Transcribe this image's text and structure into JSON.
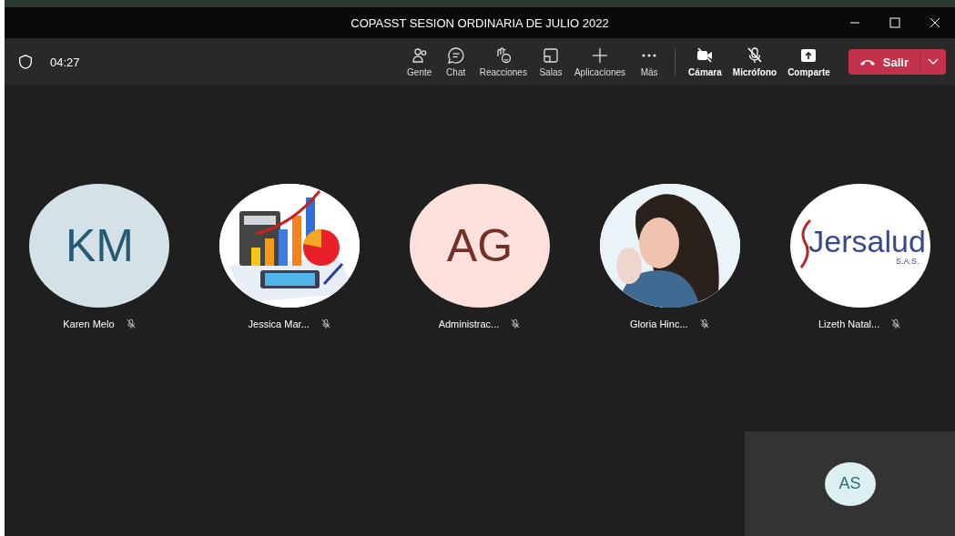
{
  "window": {
    "title": "COPASST SESION ORDINARIA DE JULIO 2022"
  },
  "meeting": {
    "timer": "04:27"
  },
  "toolbar": [
    {
      "kind": "people",
      "label": "Gente"
    },
    {
      "kind": "chat",
      "label": "Chat"
    },
    {
      "kind": "reactions",
      "label": "Reacciones"
    },
    {
      "kind": "rooms",
      "label": "Salas"
    },
    {
      "kind": "apps",
      "label": "Aplicaciones"
    },
    {
      "kind": "more",
      "label": "Más"
    }
  ],
  "controls": [
    {
      "kind": "camera",
      "label": "Cámara",
      "on": false
    },
    {
      "kind": "mic",
      "label": "Micrófono",
      "on": false
    },
    {
      "kind": "share",
      "label": "Comparte",
      "on": true
    }
  ],
  "leave_button": {
    "label": "Salir"
  },
  "participants": [
    {
      "name": "Karen Melo",
      "muted": true,
      "avatar": {
        "kind": "initials",
        "initials": "KM",
        "color": "#d4e2e8"
      }
    },
    {
      "name": "Jessica Mar...",
      "muted": true
    },
    {
      "name": "Administrac...",
      "muted": true,
      "avatar": {
        "kind": "initials",
        "initials": "AG",
        "color": "#fbe0dc"
      }
    },
    {
      "name": "Gloria Hinc...",
      "muted": true
    },
    {
      "name": "Lizeth Natal...",
      "muted": true,
      "avatar": {
        "kind": "logo",
        "text": "Jersalud",
        "subtext": "S.A.S."
      }
    }
  ],
  "self_view": {
    "initials": "AS"
  }
}
